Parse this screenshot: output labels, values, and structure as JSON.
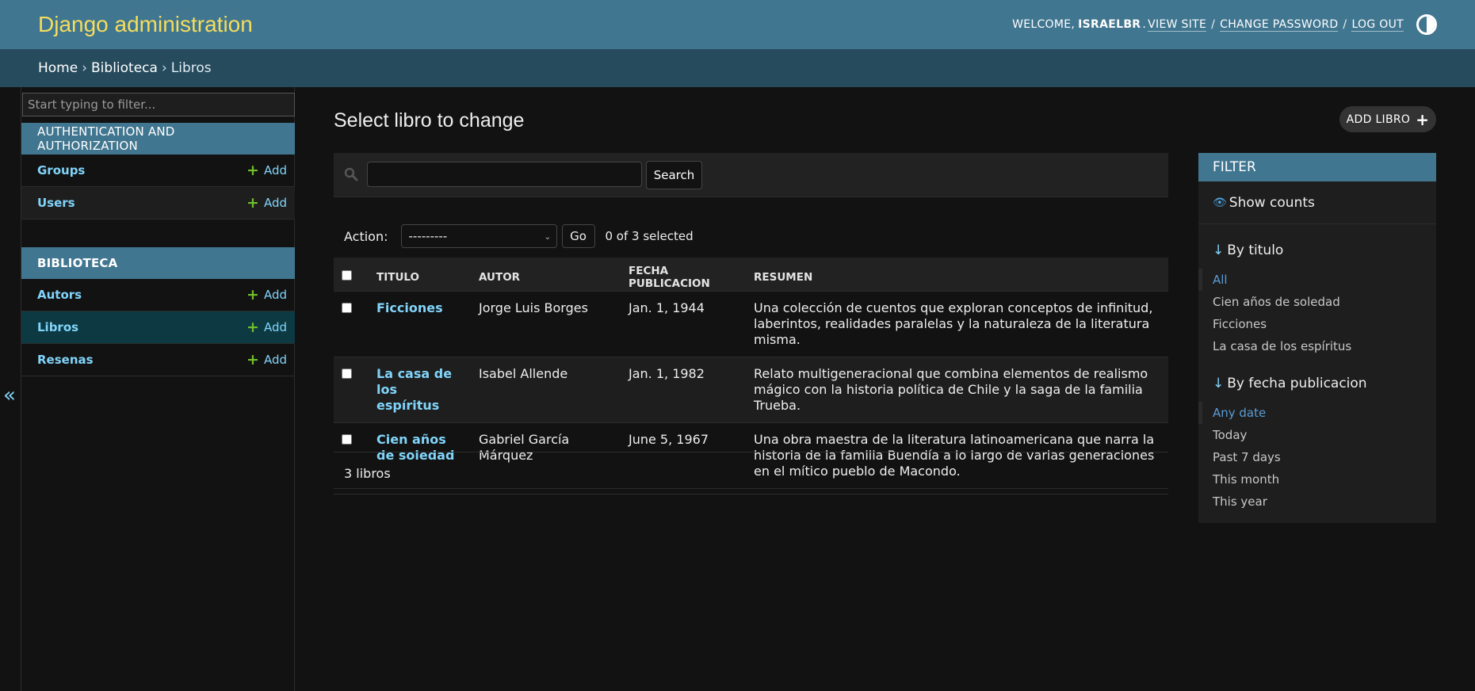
{
  "header": {
    "branding": "Django administration",
    "welcome": "WELCOME,",
    "username": "ISRAELBR",
    "view_site": "VIEW SITE",
    "change_password": "CHANGE PASSWORD",
    "log_out": "LOG OUT",
    "sep": "/"
  },
  "breadcrumbs": {
    "home": "Home",
    "app": "Biblioteca",
    "current": "Libros",
    "sep": "›"
  },
  "sidebar": {
    "filter_placeholder": "Start typing to filter...",
    "toggle": "«",
    "modules": [
      {
        "caption": "AUTHENTICATION AND AUTHORIZATION",
        "models": [
          {
            "name": "Groups",
            "add": "Add"
          },
          {
            "name": "Users",
            "add": "Add"
          }
        ]
      },
      {
        "caption": "BIBLIOTECA",
        "models": [
          {
            "name": "Autors",
            "add": "Add"
          },
          {
            "name": "Libros",
            "add": "Add"
          },
          {
            "name": "Resenas",
            "add": "Add"
          }
        ]
      }
    ]
  },
  "content": {
    "title": "Select libro to change",
    "add_button": "ADD LIBRO",
    "search_button": "Search",
    "action_label": "Action:",
    "action_default": "---------",
    "go_button": "Go",
    "selected_counter": "0 of 3 selected",
    "columns": [
      "TITULO",
      "AUTOR",
      "FECHA PUBLICACION",
      "RESUMEN"
    ],
    "rows": [
      {
        "titulo": "Ficciones",
        "autor": "Jorge Luis Borges",
        "fecha": "Jan. 1, 1944",
        "resumen": "Una colección de cuentos que exploran conceptos de infinitud, laberintos, realidades paralelas y la naturaleza de la literatura misma."
      },
      {
        "titulo": "La casa de los espíritus",
        "autor": "Isabel Allende",
        "fecha": "Jan. 1, 1982",
        "resumen": "Relato multigeneracional que combina elementos de realismo mágico con la historia política de Chile y la saga de la familia Trueba."
      },
      {
        "titulo": "Cien años de soledad",
        "autor": "Gabriel García Márquez",
        "fecha": "June 5, 1967",
        "resumen": "Una obra maestra de la literatura latinoamericana que narra la historia de la familia Buendía a lo largo de varias generaciones en el mítico pueblo de Macondo."
      }
    ],
    "paginator": "3 libros"
  },
  "filter": {
    "title": "FILTER",
    "show_counts": "Show counts",
    "by_titulo": {
      "heading": "By titulo",
      "options": [
        "All",
        "Cien años de soledad",
        "Ficciones",
        "La casa de los espíritus"
      ],
      "selected": "All"
    },
    "by_fecha": {
      "heading": "By fecha publicacion",
      "options": [
        "Any date",
        "Today",
        "Past 7 days",
        "This month",
        "This year"
      ],
      "selected": "Any date"
    }
  },
  "colors": {
    "header_bg": "#417690",
    "breadcrumbs_bg": "#264b5d",
    "branding": "#f5dd5d",
    "link": "#81d4fa",
    "add_plus": "#70bf2b",
    "current_model_bg": "#0d3a42"
  }
}
